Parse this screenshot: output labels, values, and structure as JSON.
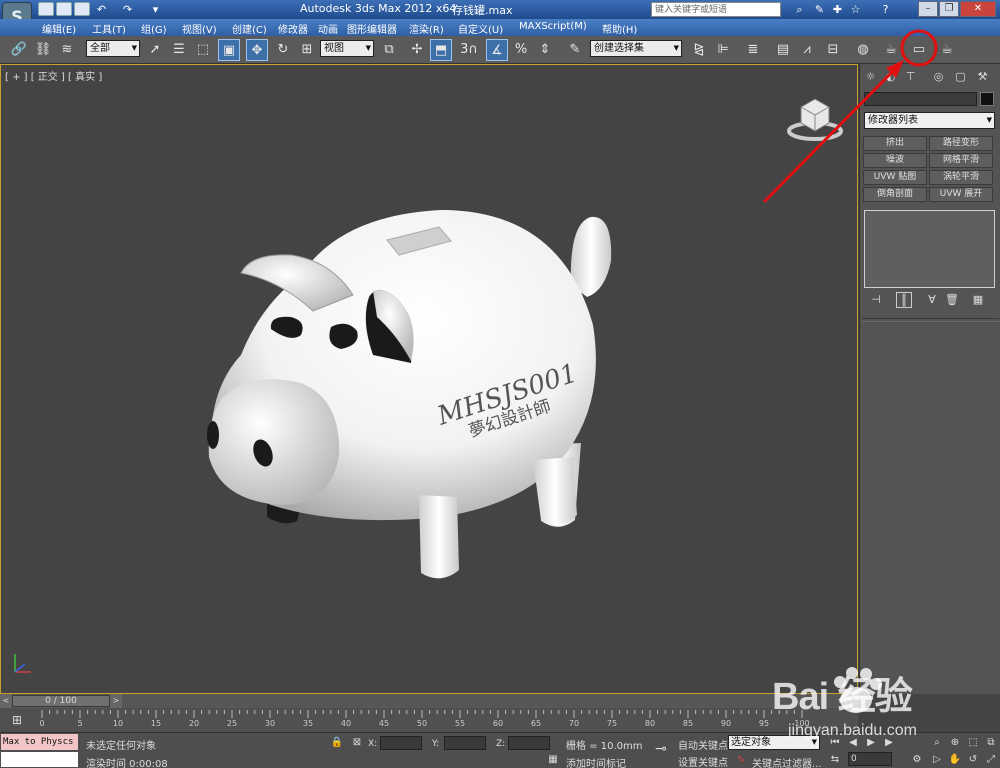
{
  "titlebar": {
    "title": "Autodesk 3ds Max  2012 x64",
    "filename": "存钱罐.max",
    "search_placeholder": "键入关键字或短语"
  },
  "menu": {
    "items": [
      "编辑(E)",
      "工具(T)",
      "组(G)",
      "视图(V)",
      "创建(C)",
      "修改器",
      "动画",
      "图形编辑器",
      "渲染(R)",
      "自定义(U)",
      "MAXScript(M)",
      "帮助(H)"
    ]
  },
  "toolbar": {
    "selection_filter": "全部",
    "ref_coord": "视图",
    "named_selection": "创建选择集",
    "snap_value": "3"
  },
  "viewport": {
    "label": "[ + ] [ 正交 ] [ 真实 ]",
    "text_line1": "MHSJS001",
    "text_line2": "夢幻設計師"
  },
  "command_panel": {
    "modifier_list": "修改器列表",
    "modifier_buttons": [
      "挤出",
      "路径变形",
      "噪波",
      "网格平滑",
      "UVW 贴图",
      "涡轮平滑",
      "倒角剖面",
      "UVW 展开"
    ]
  },
  "timeslider": {
    "position": "0 / 100",
    "ticks": [
      "0",
      "5",
      "10",
      "15",
      "20",
      "25",
      "30",
      "35",
      "40",
      "45",
      "50",
      "55",
      "60",
      "65",
      "70",
      "75",
      "80",
      "85",
      "90",
      "95",
      "100"
    ]
  },
  "statusbar": {
    "maxscript": "Max to Physcs (",
    "status": "未选定任何对象",
    "prompt": "渲染时间  0:00:08",
    "x_label": "X:",
    "y_label": "Y:",
    "z_label": "Z:",
    "grid": "栅格 = 10.0mm",
    "add_time_tag": "添加时间标记",
    "auto_key": "自动关键点",
    "set_key": "设置关键点",
    "selected": "选定对象",
    "key_filters": "关键点过滤器...",
    "frame": "0"
  },
  "watermark": {
    "brand": "Bai 经验",
    "url": "jingyan.baidu.com"
  },
  "colors": {
    "annotation": "#e01010",
    "viewport_bg": "#444444",
    "active_border": "#c8a032"
  }
}
